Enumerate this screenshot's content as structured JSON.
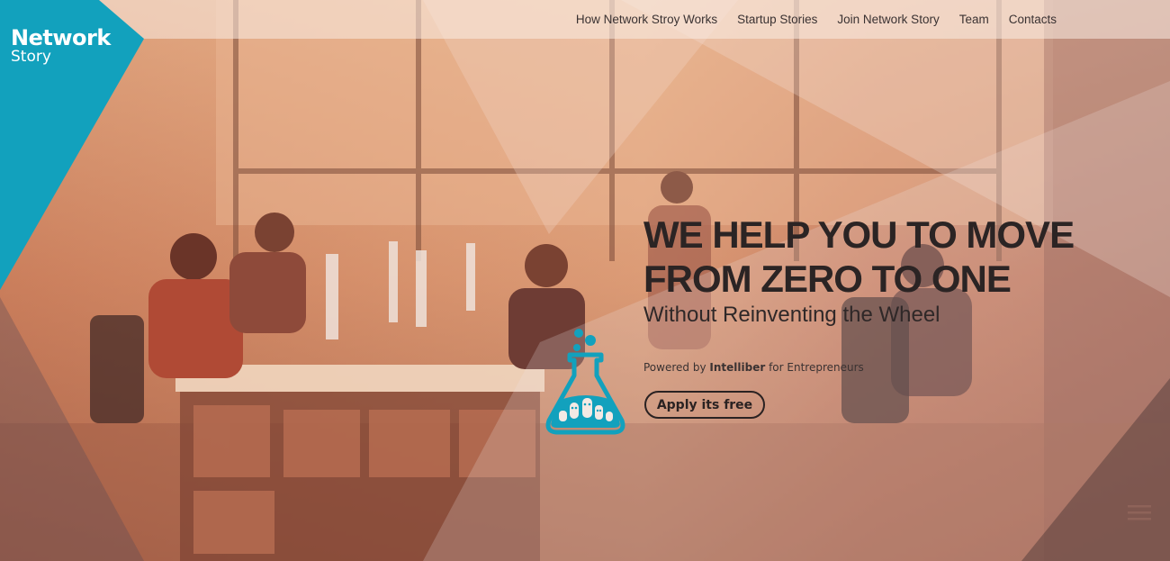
{
  "logo": {
    "line1": "Network",
    "line2": "Story"
  },
  "nav": {
    "items": [
      {
        "label": "How Network Stroy Works"
      },
      {
        "label": "Startup Stories"
      },
      {
        "label": "Join Network Story"
      },
      {
        "label": "Team"
      },
      {
        "label": "Contacts"
      }
    ]
  },
  "hero": {
    "headline_line1": "WE HELP YOU TO MOVE",
    "headline_line2": "FROM ZERO TO ONE",
    "subheadline": "Without Reinventing the Wheel",
    "powered_prefix": "Powered by ",
    "powered_brand": "Intelliber",
    "powered_suffix": " for Entrepreneurs",
    "cta_label": "Apply its free"
  },
  "icons": {
    "flask": "flask-icon",
    "menu": "hamburger-menu-icon"
  },
  "colors": {
    "brand_teal": "#12a1bd",
    "headline_text": "#2b2424",
    "overlay_light": "#f3e5e2"
  }
}
